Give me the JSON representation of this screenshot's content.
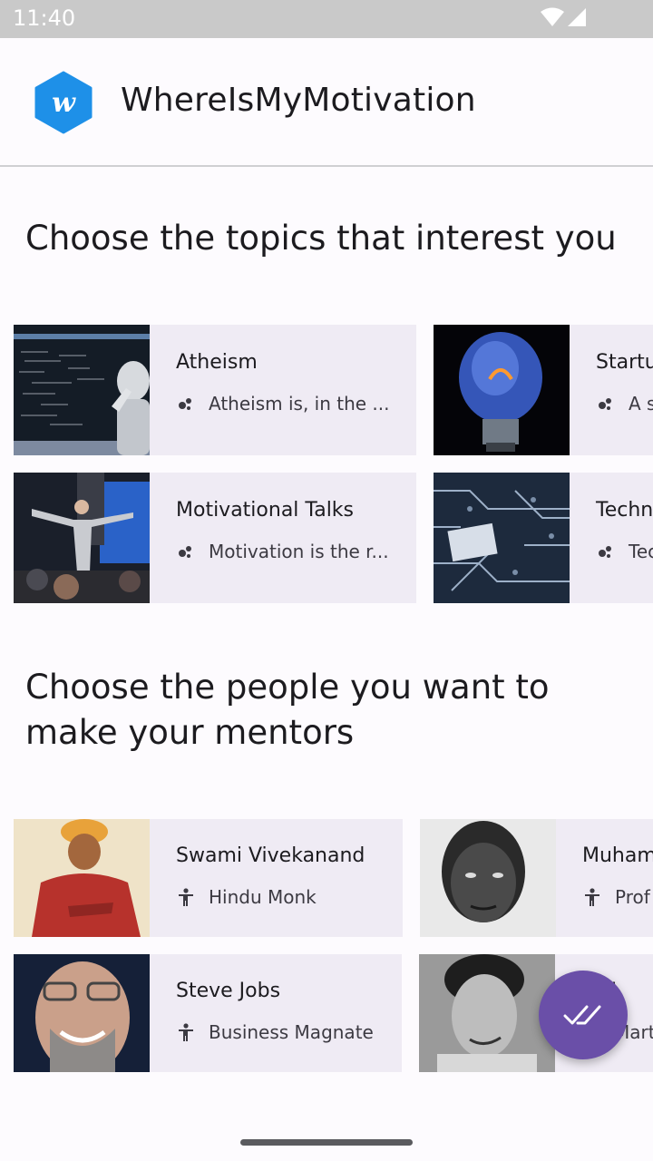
{
  "status": {
    "time": "11:40"
  },
  "app": {
    "title": "WhereIsMyMotivation",
    "logo_letter": "w"
  },
  "topics_section": {
    "heading": "Choose the topics that interest you",
    "cards": [
      {
        "title": "Atheism",
        "desc": "Atheism is, in the ...",
        "icon": "bubbles-icon"
      },
      {
        "title": "Startu",
        "desc": "A s",
        "icon": "bubbles-icon"
      },
      {
        "title": "Motivational Talks",
        "desc": "Motivation is the r...",
        "icon": "bubbles-icon"
      },
      {
        "title": "Techn",
        "desc": "Tec",
        "icon": "bubbles-icon"
      }
    ]
  },
  "people_section": {
    "heading": "Choose the people you want to make your mentors",
    "cards": [
      {
        "name": "Swami Vivekanand",
        "role": "Hindu Monk",
        "icon": "person-icon"
      },
      {
        "name": "Muham",
        "role": "Prof",
        "icon": "person-icon"
      },
      {
        "name": "Steve Jobs",
        "role": "Business Magnate",
        "icon": "person-icon"
      },
      {
        "name": "ce L",
        "role": "Mart",
        "icon": "person-icon"
      }
    ]
  },
  "fab": {
    "icon": "double-check-icon"
  },
  "colors": {
    "accent": "#6a4fa8",
    "card_bg": "#efebf4",
    "logo": "#1e90e8"
  }
}
